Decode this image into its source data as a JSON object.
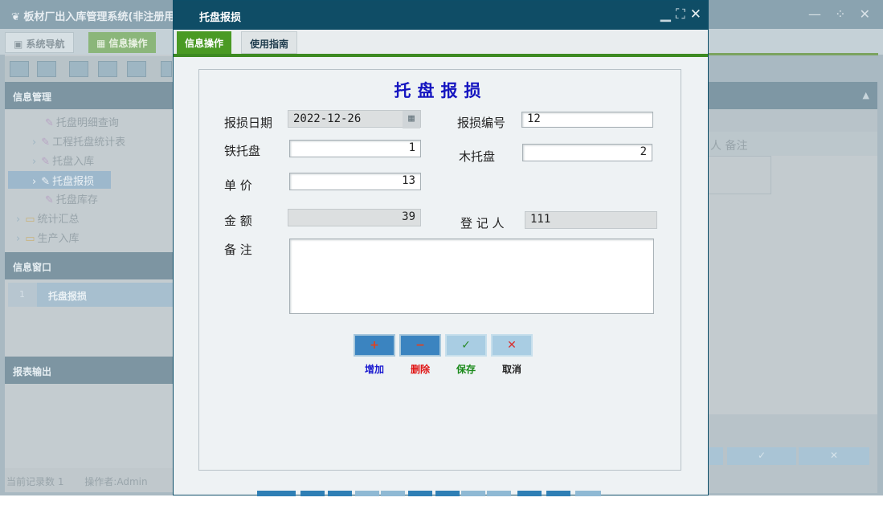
{
  "main": {
    "title": "板材厂出入库管理系统(非注册用",
    "window_controls": "— ⁘ ✕",
    "tabs": [
      {
        "label": "系统导航"
      },
      {
        "label": "信息操作"
      }
    ]
  },
  "left": {
    "section_info": "信息管理",
    "tree": [
      {
        "label": "托盘明细查询"
      },
      {
        "label": "工程托盘统计表"
      },
      {
        "label": "托盘入库"
      },
      {
        "label": "托盘报损"
      },
      {
        "label": "托盘库存"
      },
      {
        "label": "统计汇总"
      },
      {
        "label": "生产入库"
      }
    ],
    "section_window": "信息窗口",
    "window_item": "托盘报损",
    "window_item_num": "1",
    "section_report": "报表输出",
    "status_count": "当前记录数 1",
    "status_operator": "操作者:Admin"
  },
  "right": {
    "grid_header": "人   备注",
    "btn_ok": "✓",
    "btn_cancel": "✕"
  },
  "dialog": {
    "title": "托盘报损",
    "tabs": [
      {
        "label": "信息操作"
      },
      {
        "label": "使用指南"
      }
    ],
    "form_title": "托盘报损",
    "fields": {
      "date_label": "报损日期",
      "date_value": "2022-12-26",
      "number_label": "报损编号",
      "number_value": "12",
      "iron_label": "铁托盘",
      "iron_value": "1",
      "wood_label": "木托盘",
      "wood_value": "2",
      "price_label": "单 价",
      "price_value": "13",
      "amount_label": "金 额",
      "amount_value": "39",
      "registrar_label": "登 记 人",
      "registrar_value": "111",
      "remark_label": "备 注",
      "remark_value": ""
    },
    "actions": [
      {
        "icon": "+",
        "label": "增加",
        "color": "#1a1ad0"
      },
      {
        "icon": "−",
        "label": "删除",
        "color": "#e01515"
      },
      {
        "icon": "✓",
        "label": "保存",
        "color": "#1a8a1a"
      },
      {
        "icon": "✕",
        "label": "取消",
        "color": "#222222"
      }
    ]
  }
}
